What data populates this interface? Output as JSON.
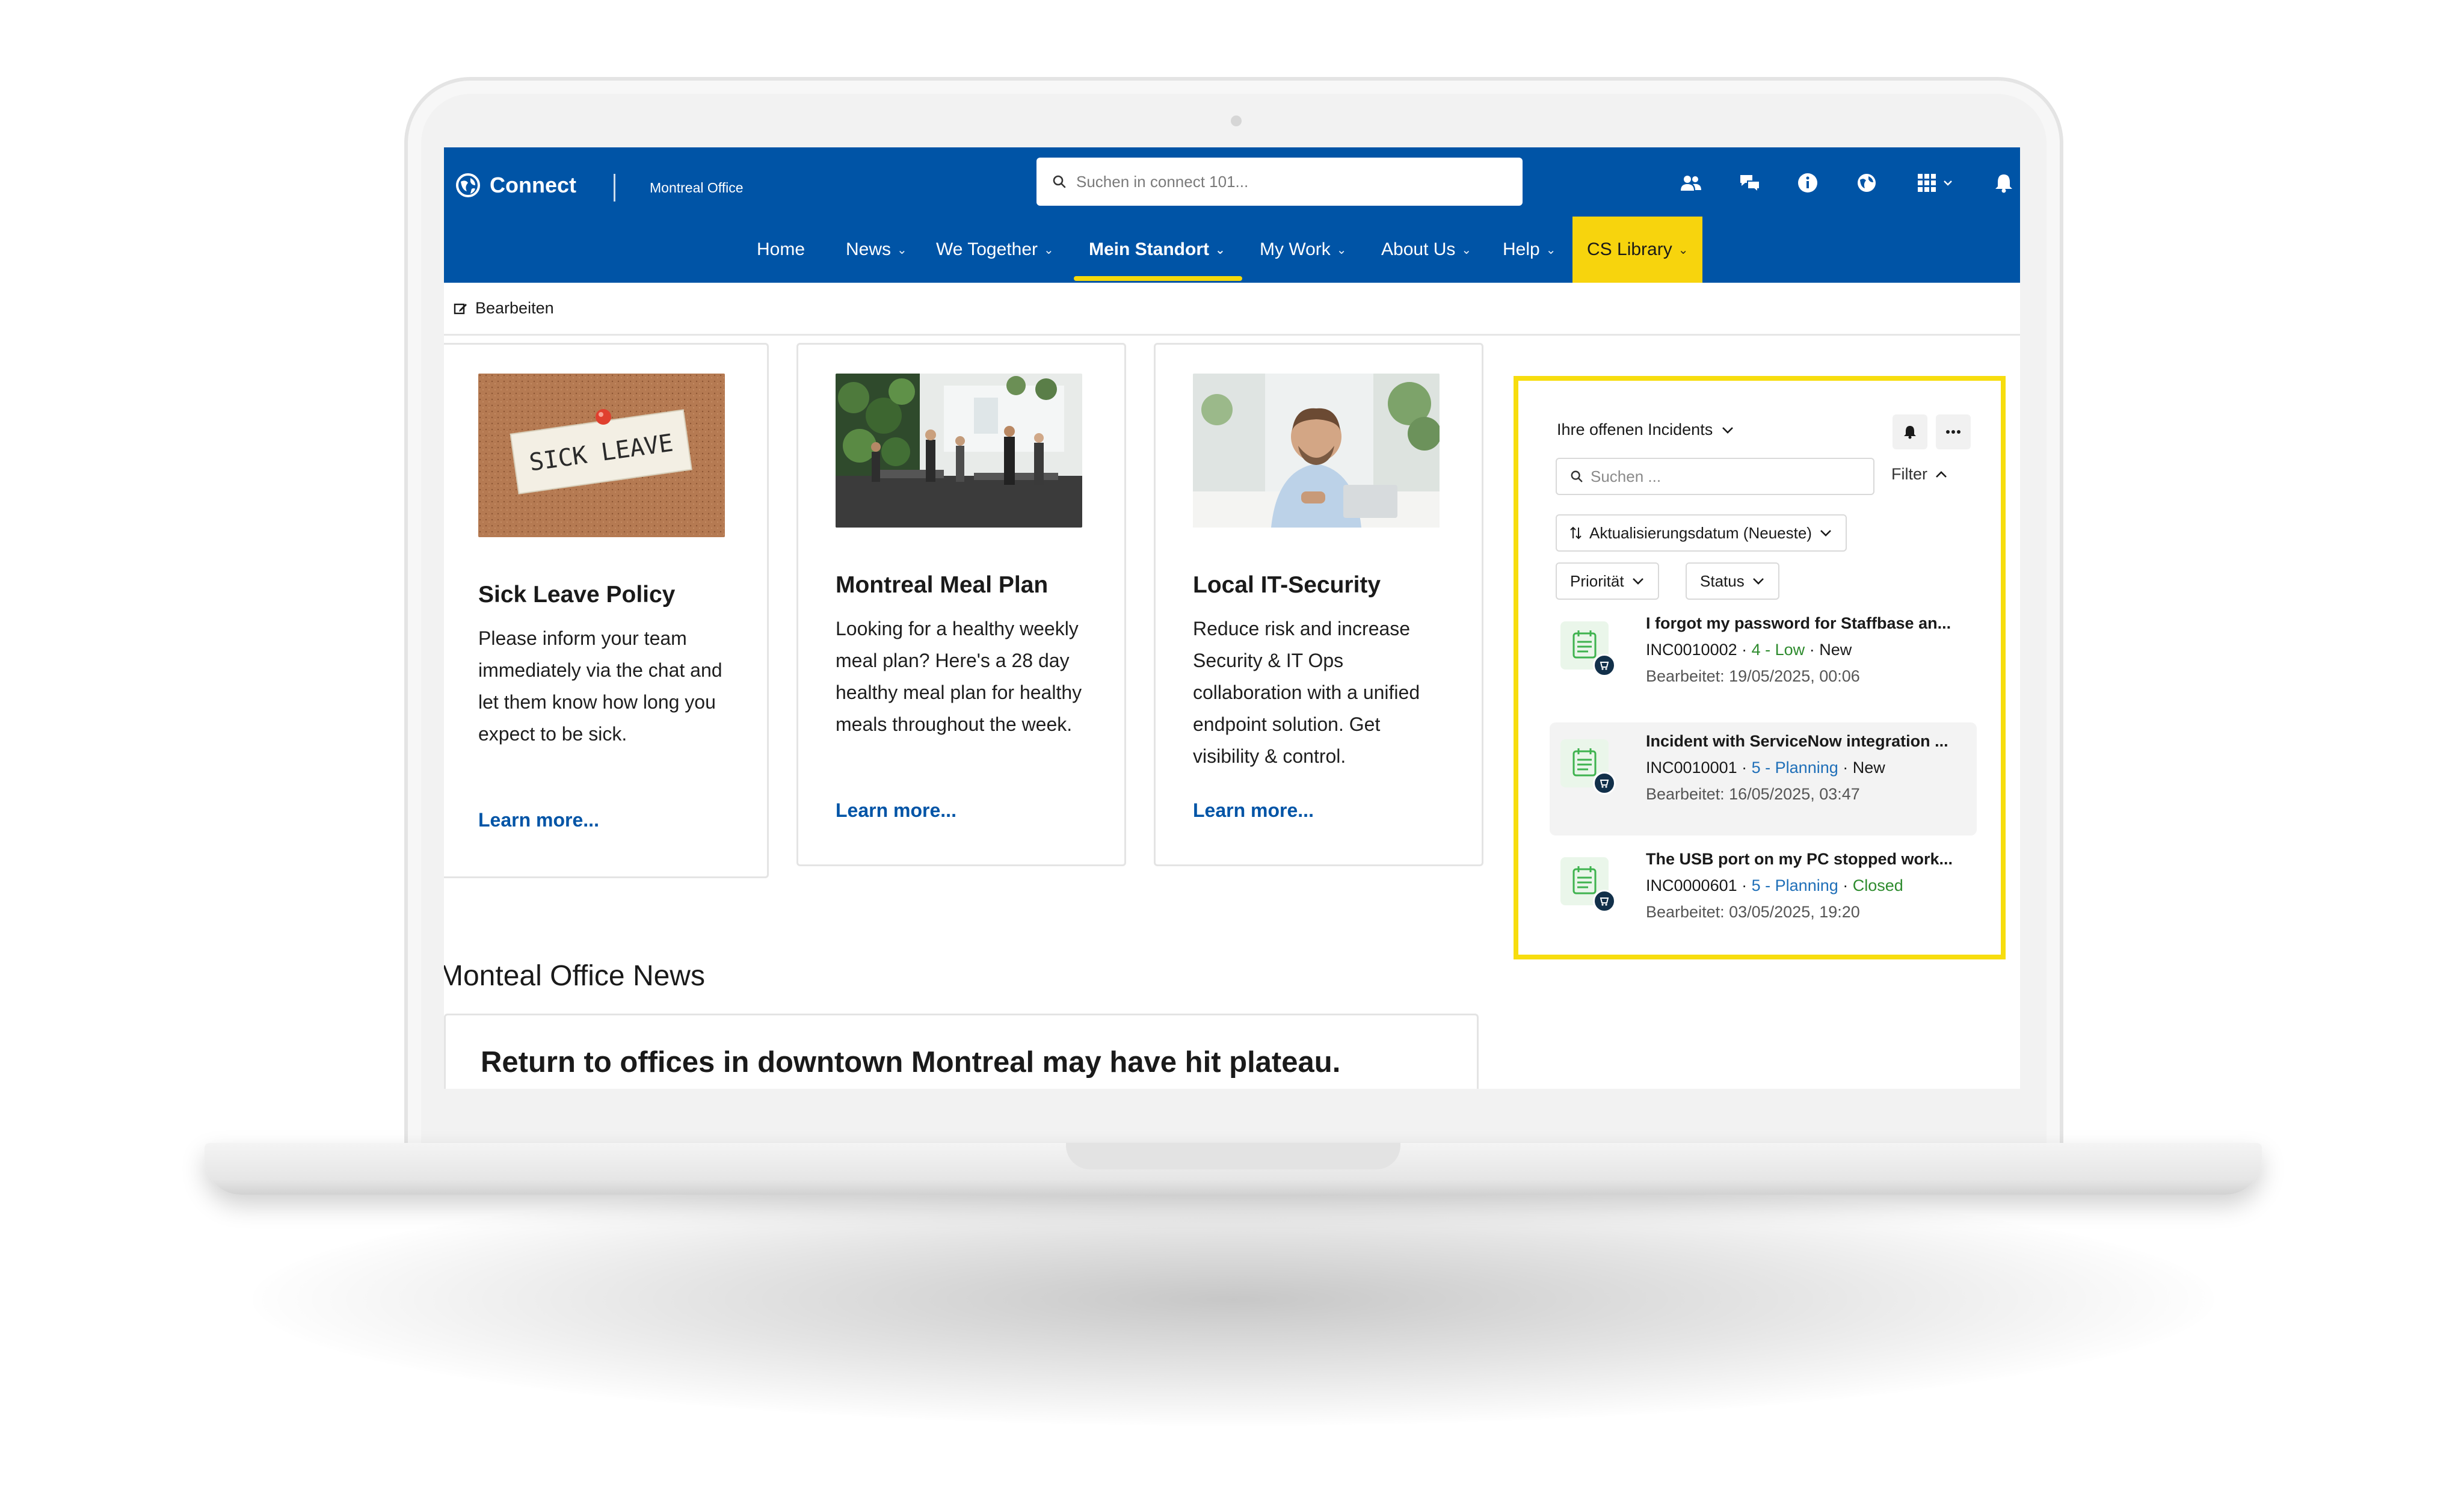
{
  "header": {
    "app_name": "Connect",
    "site_name": "Montreal Office",
    "search_placeholder": "Suchen in connect 101...",
    "brand_color": "#0054a6"
  },
  "nav": {
    "items": [
      {
        "label": "Home",
        "dropdown": false
      },
      {
        "label": "News",
        "dropdown": true
      },
      {
        "label": "We Together",
        "dropdown": true
      },
      {
        "label": "Mein Standort",
        "dropdown": true,
        "active": true
      },
      {
        "label": "My Work",
        "dropdown": true
      },
      {
        "label": "About Us",
        "dropdown": true
      },
      {
        "label": "Help",
        "dropdown": true
      },
      {
        "label": "CS Library",
        "dropdown": true,
        "highlight": true
      }
    ],
    "highlight_color": "#f7d40d"
  },
  "edit_bar": {
    "label": "Bearbeiten"
  },
  "cards": [
    {
      "image_text": "SICK LEAVE",
      "title": "Sick Leave Policy",
      "body": "Please inform your team immediately via the chat and let them know how long you expect to be sick.",
      "link": "Learn more..."
    },
    {
      "title": "Montreal Meal Plan",
      "body": "Looking for a healthy weekly meal plan? Here's a 28 day healthy meal plan for healthy meals throughout the week.",
      "link": "Learn more..."
    },
    {
      "title": "Local IT-Security",
      "body": "Reduce risk and increase Security & IT Ops collaboration with a unified endpoint solution. Get visibility & control.",
      "link": "Learn more..."
    }
  ],
  "news": {
    "section_title": "Monteal Office News",
    "headline": "Return to offices in downtown Montreal may have hit plateau."
  },
  "incidents_widget": {
    "heading": "Ihre offenen Incidents",
    "search_placeholder": "Suchen ...",
    "filter_label": "Filter",
    "sort_label": "Aktualisierungsdatum (Neueste)",
    "filter_chips": [
      "Priorität",
      "Status"
    ],
    "border_color": "#f7dd0e",
    "items": [
      {
        "title": "I forgot my password for Staffbase an...",
        "number": "INC0010002",
        "priority": "4 - Low",
        "priority_color": "#2e8b2e",
        "status": "New",
        "status_color": "#1a1a1a",
        "edited": "Bearbeitet: 19/05/2025, 00:06"
      },
      {
        "title": "Incident with ServiceNow integration ...",
        "number": "INC0010001",
        "priority": "5 - Planning",
        "priority_color": "#1f6fb8",
        "status": "New",
        "status_color": "#1a1a1a",
        "edited": "Bearbeitet: 16/05/2025, 03:47"
      },
      {
        "title": "The USB port on my PC stopped work...",
        "number": "INC0000601",
        "priority": "5 - Planning",
        "priority_color": "#1f6fb8",
        "status": "Closed",
        "status_color": "#2e8b2e",
        "edited": "Bearbeitet: 03/05/2025, 19:20"
      }
    ]
  }
}
